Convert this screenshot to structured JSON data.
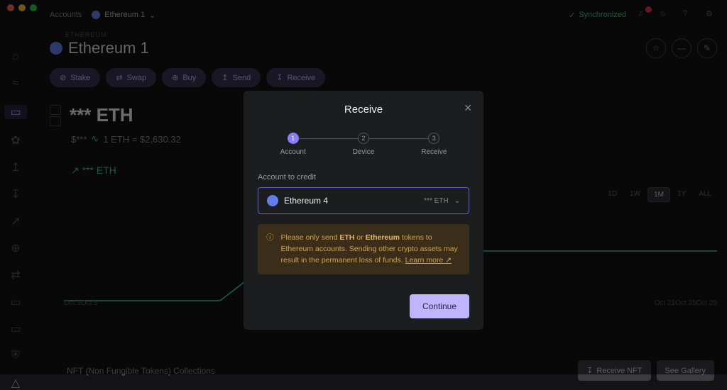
{
  "topbar": {
    "accounts": "Accounts",
    "selected_account": "Ethereum 1",
    "sync_label": "Synchronized"
  },
  "header": {
    "breadcrumb": "ETHEREUM",
    "title": "Ethereum 1"
  },
  "actions": {
    "stake": "Stake",
    "swap": "Swap",
    "buy": "Buy",
    "send": "Send",
    "receive": "Receive"
  },
  "balance": {
    "main": "*** ETH",
    "fiat_prefix": "$***",
    "rate": "1 ETH = $2,630.32",
    "delta": "↗ *** ETH"
  },
  "ranges": {
    "d1": "1D",
    "w1": "1W",
    "m1": "1M",
    "y1": "1Y",
    "all": "ALL"
  },
  "xaxis": {
    "t0": "Oct 1",
    "t1": "Oct 5",
    "t2": "Oct 21",
    "t3": "Oct 25",
    "t4": "Oct 29"
  },
  "nft": {
    "title": "NFT (Non Fungible Tokens) Collections",
    "receive": "Receive NFT",
    "gallery": "See Gallery"
  },
  "modal": {
    "title": "Receive",
    "step1": "Account",
    "step2": "Device",
    "step3": "Receive",
    "field_label": "Account to credit",
    "select_name": "Ethereum 4",
    "select_balance": "*** ETH",
    "warn_pre": "Please only send ",
    "warn_b1": "ETH",
    "warn_mid": " or ",
    "warn_b2": "Ethereum",
    "warn_post": " tokens to Ethereum accounts. Sending other crypto assets may result in the permanent loss of funds. ",
    "learn": "Learn more",
    "continue": "Continue"
  }
}
